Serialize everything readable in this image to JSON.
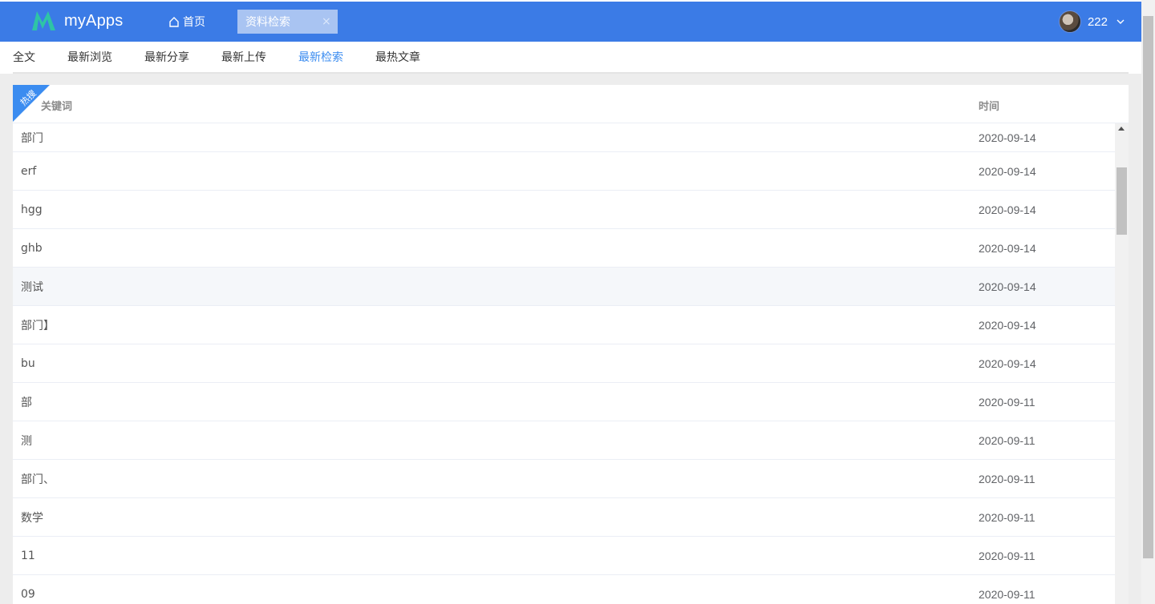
{
  "app": {
    "logo_text": "myApps"
  },
  "header": {
    "home_tab_label": "首页",
    "active_tab_label": "资料检索",
    "close_glyph": "×",
    "username": "222"
  },
  "subnav": {
    "items": [
      {
        "label": "全文",
        "active": false
      },
      {
        "label": "最新浏览",
        "active": false
      },
      {
        "label": "最新分享",
        "active": false
      },
      {
        "label": "最新上传",
        "active": false
      },
      {
        "label": "最新检索",
        "active": true
      },
      {
        "label": "最热文章",
        "active": false
      }
    ]
  },
  "table": {
    "ribbon_label": "热搜",
    "columns": {
      "keyword": "关键词",
      "time": "时间"
    },
    "rows": [
      {
        "keyword": "部门",
        "time": "2020-09-14"
      },
      {
        "keyword": "erf",
        "time": "2020-09-14"
      },
      {
        "keyword": "hgg",
        "time": "2020-09-14"
      },
      {
        "keyword": "ghb",
        "time": "2020-09-14"
      },
      {
        "keyword": "测试",
        "time": "2020-09-14"
      },
      {
        "keyword": "部门】",
        "time": "2020-09-14"
      },
      {
        "keyword": "bu",
        "time": "2020-09-14"
      },
      {
        "keyword": "部",
        "time": "2020-09-11"
      },
      {
        "keyword": "测",
        "time": "2020-09-11"
      },
      {
        "keyword": "部门、",
        "time": "2020-09-11"
      },
      {
        "keyword": "数学",
        "time": "2020-09-11"
      },
      {
        "keyword": "11",
        "time": "2020-09-11"
      },
      {
        "keyword": "09",
        "time": "2020-09-11"
      }
    ]
  },
  "colors": {
    "header_bg": "#3b7be6",
    "accent": "#3b8cf0",
    "logo_green": "#2ec4a6"
  }
}
